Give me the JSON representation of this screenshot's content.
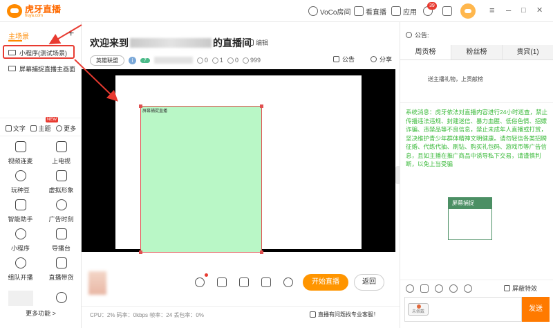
{
  "app": {
    "logo_text": "虎牙直播",
    "logo_sub": "huya.com"
  },
  "topbar": {
    "voco": "VoCo房间",
    "watch": "看直播",
    "apps": "应用",
    "badge_count": "39",
    "win_min": "–",
    "win_max": "□",
    "win_close": "✕"
  },
  "scenes": {
    "header": "主场景",
    "add": "+",
    "items": [
      {
        "label": "小程序(测试场景)"
      },
      {
        "label": "屏幕捕捉直播主画面"
      }
    ]
  },
  "tools": {
    "text": "文字",
    "theme": "主题",
    "more": "更多",
    "hot_badge": "NEW"
  },
  "features": [
    {
      "label": "视频连麦"
    },
    {
      "label": "上电视"
    },
    {
      "label": "玩种豆"
    },
    {
      "label": "虚拟形象"
    },
    {
      "label": "智能助手"
    },
    {
      "label": "广告时刻"
    },
    {
      "label": "小程序"
    },
    {
      "label": "导播台"
    },
    {
      "label": "组队开播"
    },
    {
      "label": "直播带货"
    }
  ],
  "more_features": "更多功能 >",
  "room": {
    "title_prefix": "欢迎来到",
    "title_suffix": "的直播间",
    "edit": "编辑",
    "category": "英雄联盟",
    "level": "7",
    "stats": [
      "0",
      "1",
      "0",
      "999"
    ],
    "notice": "公告",
    "share": "分享",
    "canvas_label": "屏幕捕捉直播"
  },
  "controls": {
    "start": "开始直播",
    "back": "返回"
  },
  "status": {
    "metrics": "CPU：2%  码率：0kbps  帧率：24  丢包率：0%",
    "support": "直播有问题找专业客服！"
  },
  "right": {
    "notice_label": "公告:",
    "tabs": [
      "周贡榜",
      "粉丝榜",
      "贵宾(1)"
    ],
    "gift_line": "送主播礼物，上贡献榜",
    "system_message": "系统消息：虎牙依法对直播内容进行24小时巡查，禁止传播违法违规、封建迷信、暴力血腥、低俗色情、招嫖诈骗、违禁品等不良信息，禁止未成年人直播或打赏，坚决维护青少年群体精神文明健康。请勿轻信各类招聘征婚、代练代抽、刷钻、购买礼包码、游戏币等广告信息，且如主播在推广商品中诱导私下交易，请谨慎判断，以免上当受骗",
    "screen_card": "屏幕捕捉",
    "shield_effect": "屏蔽特效",
    "fan_badge": "未佩戴",
    "send": "发送"
  },
  "colors": {
    "accent": "#ff9500",
    "system_green": "#3aba3a",
    "highlight_red": "#e83a30"
  }
}
